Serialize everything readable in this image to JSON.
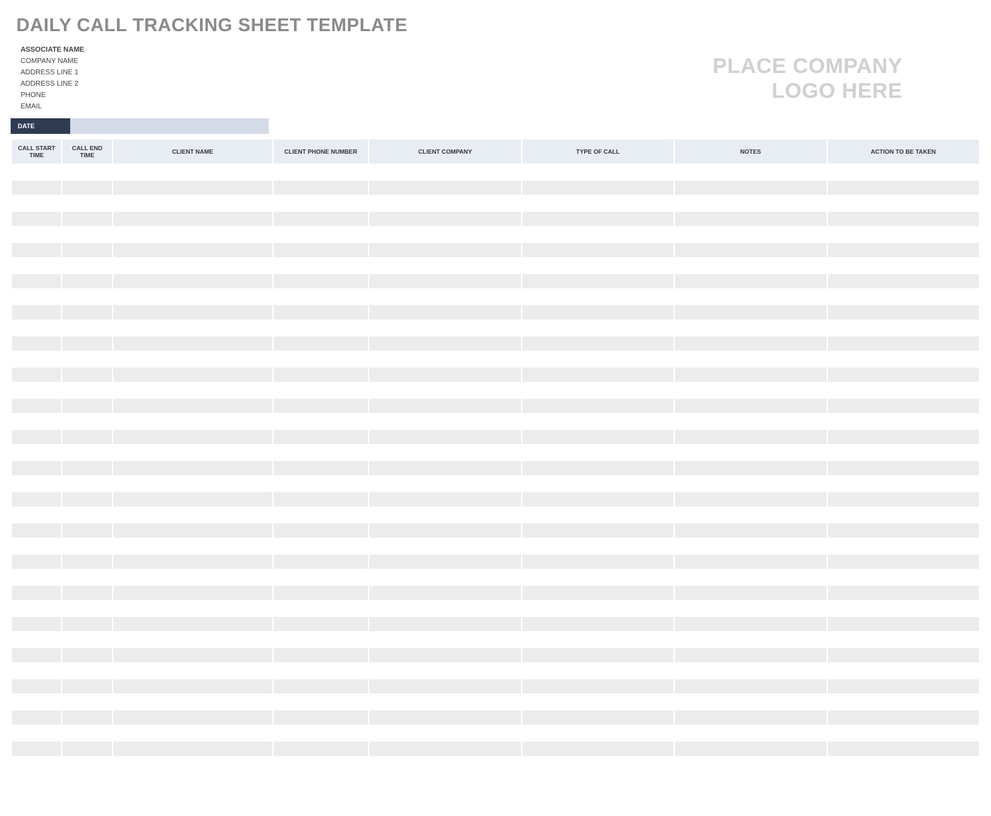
{
  "title": "DAILY CALL TRACKING SHEET TEMPLATE",
  "associate": {
    "name_label": "ASSOCIATE NAME",
    "company": "COMPANY NAME",
    "address1": "ADDRESS LINE 1",
    "address2": "ADDRESS LINE 2",
    "phone": "PHONE",
    "email": "EMAIL"
  },
  "logo_placeholder_line1": "PLACE COMPANY",
  "logo_placeholder_line2": "LOGO HERE",
  "date_label": "DATE",
  "date_value": "",
  "columns": {
    "start": "CALL START TIME",
    "end": "CALL END TIME",
    "client_name": "CLIENT NAME",
    "client_phone": "CLIENT PHONE NUMBER",
    "client_company": "CLIENT COMPANY",
    "type": "TYPE OF CALL",
    "notes": "NOTES",
    "action": "ACTION TO BE TAKEN"
  },
  "row_count": 38
}
